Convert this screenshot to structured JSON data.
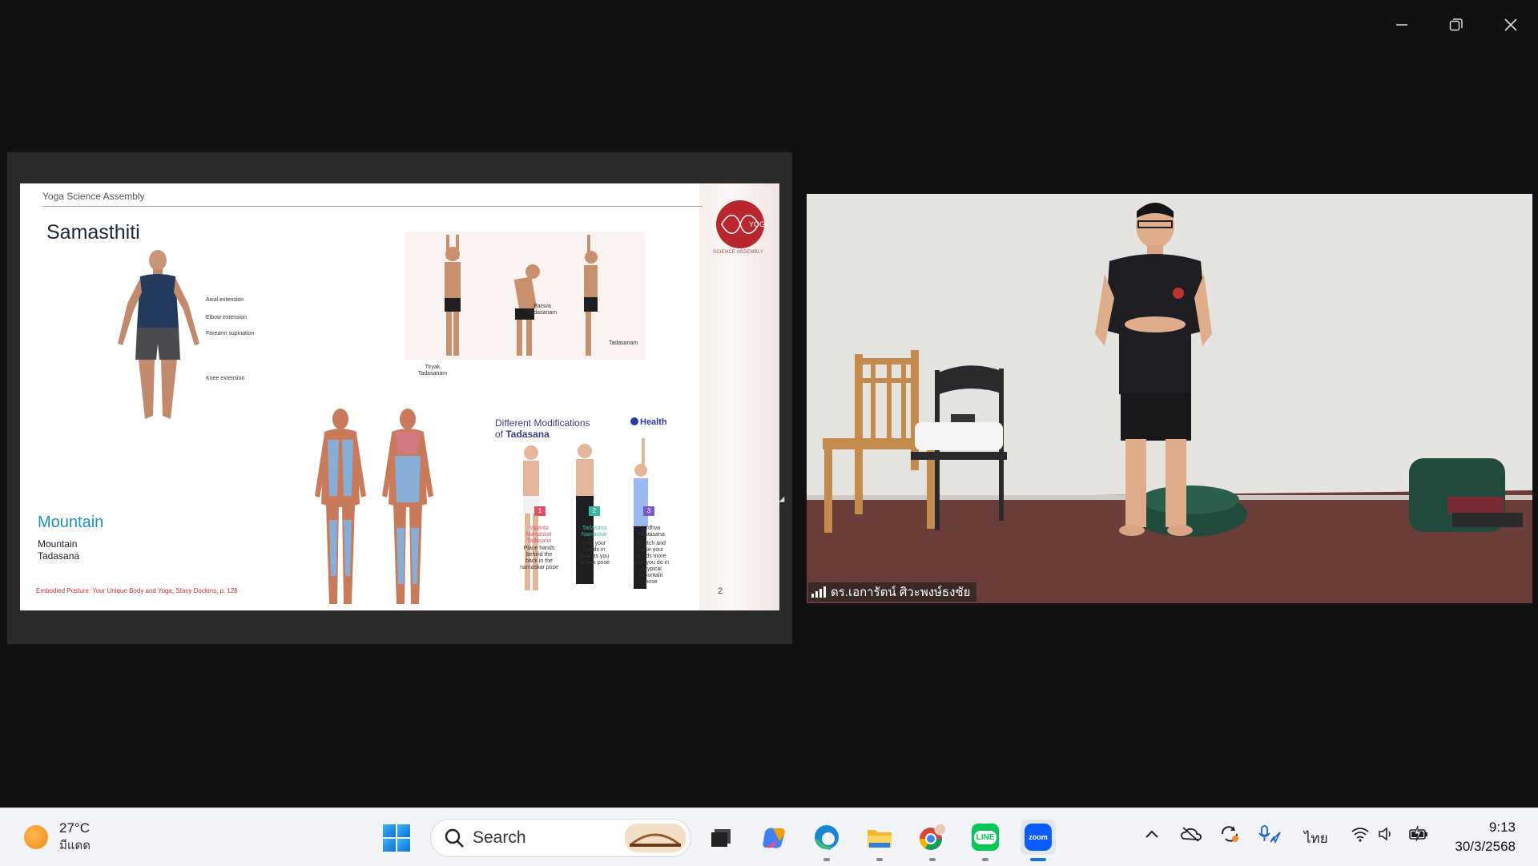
{
  "window": {
    "minimize": "minimize",
    "restore": "restore",
    "close": "close"
  },
  "slide": {
    "header": "Yoga Science Assembly",
    "title": "Samasthiti",
    "logo_text": "YOGA",
    "logo_caption": "SCIENCE ASSEMBLY",
    "muscle_labels": [
      "Axial extension",
      "Elbow extension",
      "Forearm supination",
      "Knee extension"
    ],
    "pose_labels": [
      "Tiryak Tadasanam",
      "Parsva Tadasanam",
      "Tadasanam"
    ],
    "mountain_title": "Mountain",
    "mountain_sub": "Mountain\nTadasana",
    "citation": "Embodied Posture: Your Unique Body and Yoga, Stacy Dockins, p. 128",
    "mod_title_line1": "Different Modifications",
    "mod_title_of": "of ",
    "mod_title_bold": "Tadasana",
    "health_brand": "Health",
    "mods": [
      {
        "num": "1",
        "name": "Viparita Namaskar Tadasana",
        "desc": "Place hands behind the back in the namaskar pose",
        "color": "#e0506a"
      },
      {
        "num": "2",
        "name": "Tadasana Namaskar",
        "desc": "Join your hands in front as you do this pose",
        "color": "#3cb6a4"
      },
      {
        "num": "3",
        "name": "Urdhva Hastasana",
        "desc": "Stretch and raise your hands more than you do in a typical mountain pose",
        "color": "#7b5cc6"
      }
    ],
    "page_number": "2"
  },
  "video": {
    "participant_name": "ดร.เอการัตน์ ศิวะพงษ์ธงชัย"
  },
  "taskbar": {
    "temperature": "27°C",
    "weather_desc": "มีแดด",
    "search_placeholder": "Search",
    "line_label": "LINE",
    "zoom_label": "zoom",
    "language": "ไทย",
    "time": "9:13",
    "date": "30/3/2568"
  }
}
